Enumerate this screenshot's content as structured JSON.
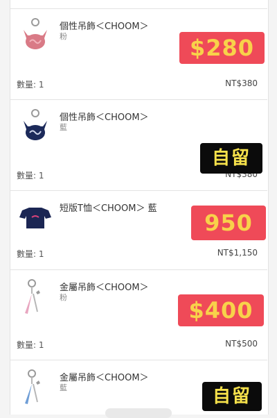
{
  "items": [
    {
      "name": "個性吊飾＜CHOOM＞",
      "variant": "粉",
      "quantity": "數量: 1",
      "price": "NT$380",
      "overlay": "$280",
      "colors": {
        "body": "#d97a86",
        "accent": "#f2b3bb"
      }
    },
    {
      "name": "個性吊飾＜CHOOM＞",
      "variant": "藍",
      "quantity": "數量: 1",
      "price": "NT$380",
      "overlay": "自留",
      "colors": {
        "body": "#1c2a5a",
        "accent": "#cfd6ea"
      }
    },
    {
      "name": "短版T恤＜CHOOM＞ 藍",
      "variant": "",
      "quantity": "數量: 1",
      "price": "NT$1,150",
      "overlay": "950",
      "colors": {
        "body": "#1b2653",
        "accent": "#d9437a"
      }
    },
    {
      "name": "金屬吊飾＜CHOOM＞",
      "variant": "粉",
      "quantity": "數量: 1",
      "price": "NT$500",
      "overlay": "$400",
      "colors": {
        "body": "#e8a6c0",
        "accent": "#b7b7b7"
      }
    },
    {
      "name": "金屬吊飾＜CHOOM＞",
      "variant": "藍",
      "quantity": "",
      "price": "",
      "overlay": "自留",
      "colors": {
        "body": "#6f9ed6",
        "accent": "#b7b7b7"
      }
    }
  ]
}
